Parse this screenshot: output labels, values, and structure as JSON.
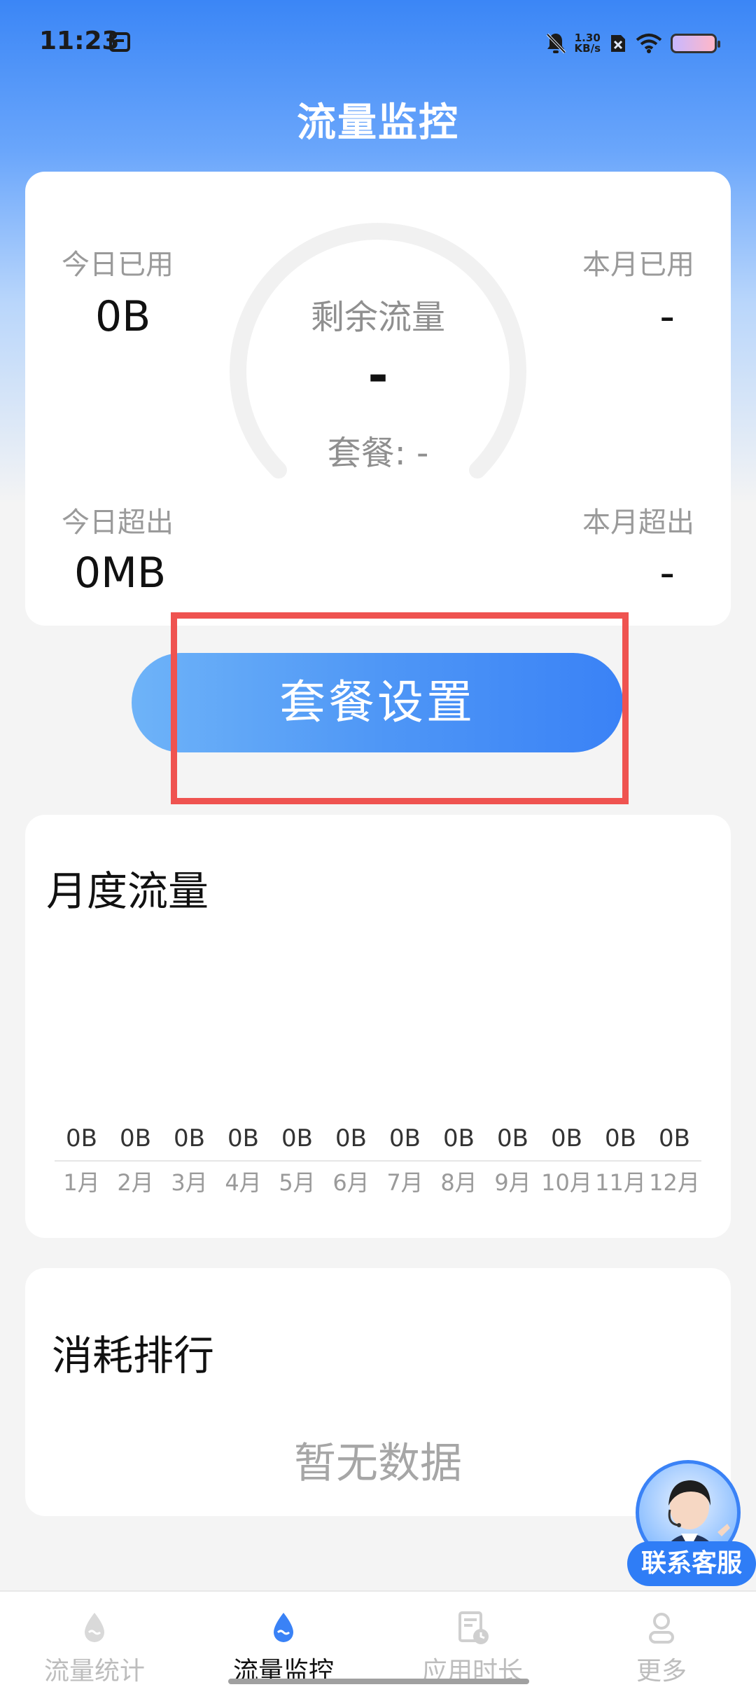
{
  "status_bar": {
    "time": "11:23",
    "net_speed_value": "1.30",
    "net_speed_unit": "KB/s"
  },
  "header": {
    "title": "流量监控"
  },
  "usage": {
    "today_used_label": "今日已用",
    "today_used_value": "0B",
    "month_used_label": "本月已用",
    "month_used_value": "-",
    "today_over_label": "今日超出",
    "today_over_value": "0MB",
    "month_over_label": "本月超出",
    "month_over_value": "-",
    "remaining_label": "剩余流量",
    "remaining_value": "-",
    "plan_text": "套餐: -"
  },
  "plan_button_label": "套餐设置",
  "monthly": {
    "title": "月度流量",
    "values": [
      "0B",
      "0B",
      "0B",
      "0B",
      "0B",
      "0B",
      "0B",
      "0B",
      "0B",
      "0B",
      "0B",
      "0B"
    ],
    "months": [
      "1月",
      "2月",
      "3月",
      "4月",
      "5月",
      "6月",
      "7月",
      "8月",
      "9月",
      "10月",
      "11月",
      "12月"
    ]
  },
  "ranking": {
    "title": "消耗排行",
    "empty_text": "暂无数据"
  },
  "service_button_label": "联系客服",
  "bottom_nav": {
    "items": [
      {
        "label": "流量统计",
        "icon": "drop-icon",
        "active": false
      },
      {
        "label": "流量监控",
        "icon": "drop-icon",
        "active": true
      },
      {
        "label": "应用时长",
        "icon": "app-time-icon",
        "active": false
      },
      {
        "label": "更多",
        "icon": "person-icon",
        "active": false
      }
    ]
  },
  "colors": {
    "accent": "#3a82f6",
    "highlight": "#ef5350"
  }
}
